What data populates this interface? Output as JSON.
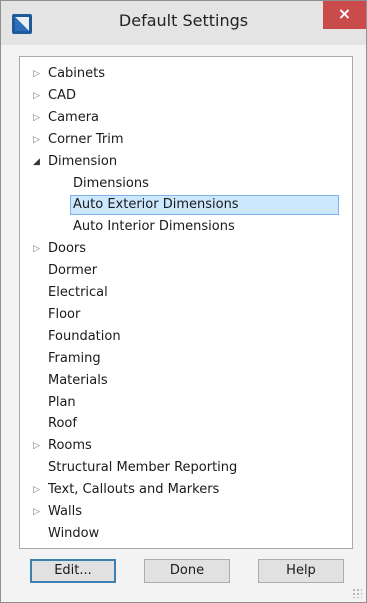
{
  "window": {
    "title": "Default Settings",
    "close_label": "×"
  },
  "tree": {
    "items": [
      {
        "label": "Cabinets",
        "level": 0,
        "expander": "collapsed"
      },
      {
        "label": "CAD",
        "level": 0,
        "expander": "collapsed"
      },
      {
        "label": "Camera",
        "level": 0,
        "expander": "collapsed"
      },
      {
        "label": "Corner Trim",
        "level": 0,
        "expander": "collapsed"
      },
      {
        "label": "Dimension",
        "level": 0,
        "expander": "expanded"
      },
      {
        "label": "Dimensions",
        "level": 1,
        "expander": "none"
      },
      {
        "label": "Auto Exterior Dimensions",
        "level": 1,
        "expander": "none",
        "selected": true
      },
      {
        "label": "Auto Interior Dimensions",
        "level": 1,
        "expander": "none"
      },
      {
        "label": "Doors",
        "level": 0,
        "expander": "collapsed"
      },
      {
        "label": "Dormer",
        "level": 0,
        "expander": "none"
      },
      {
        "label": "Electrical",
        "level": 0,
        "expander": "none"
      },
      {
        "label": "Floor",
        "level": 0,
        "expander": "none"
      },
      {
        "label": "Foundation",
        "level": 0,
        "expander": "none"
      },
      {
        "label": "Framing",
        "level": 0,
        "expander": "none"
      },
      {
        "label": "Materials",
        "level": 0,
        "expander": "none"
      },
      {
        "label": "Plan",
        "level": 0,
        "expander": "none"
      },
      {
        "label": "Roof",
        "level": 0,
        "expander": "none"
      },
      {
        "label": "Rooms",
        "level": 0,
        "expander": "collapsed"
      },
      {
        "label": "Structural Member Reporting",
        "level": 0,
        "expander": "none"
      },
      {
        "label": "Text, Callouts and Markers",
        "level": 0,
        "expander": "collapsed"
      },
      {
        "label": "Walls",
        "level": 0,
        "expander": "collapsed"
      },
      {
        "label": "Window",
        "level": 0,
        "expander": "none"
      }
    ],
    "expander_glyphs": {
      "collapsed": "▷",
      "expanded": "◢"
    }
  },
  "buttons": {
    "edit": "Edit...",
    "done": "Done",
    "help": "Help"
  },
  "colors": {
    "selection_bg": "#cce8ff",
    "selection_border": "#7eb4ea",
    "close_bg": "#c94b4b"
  },
  "icons": {
    "app": "chief-architect-logo-icon",
    "close": "close-icon",
    "collapsed": "triangle-right-outline-icon",
    "expanded": "triangle-down-right-filled-icon",
    "resize": "resize-grip-icon"
  }
}
